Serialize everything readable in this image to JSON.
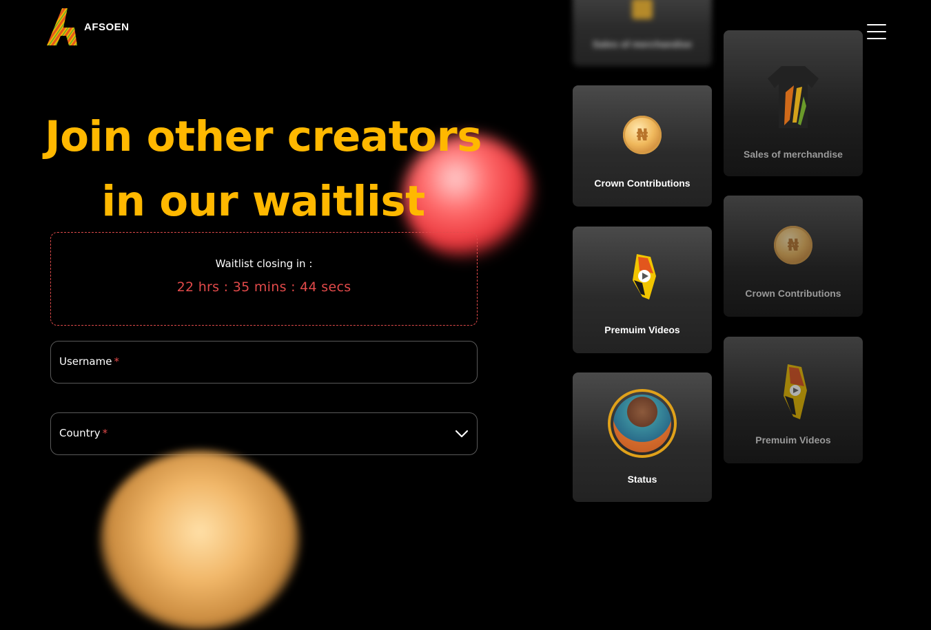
{
  "brand": {
    "name": "AFSOEN",
    "accent": "#ffb800",
    "danger": "#e24a4a"
  },
  "hero": {
    "line1": "Join other creators",
    "line2": "in our waitlist"
  },
  "countdown": {
    "label": "Waitlist closing in :",
    "value": "22 hrs : 35 mins : 44 secs"
  },
  "form": {
    "username_label": "Username",
    "country_label": "Country",
    "required_mark": "*"
  },
  "cards": {
    "top_partial": {
      "label": "Sales of merchandise"
    },
    "crown_1": {
      "label": "Crown Contributions",
      "icon": "naira-coin-icon"
    },
    "merch": {
      "label": "Sales of merchandise",
      "icon": "tshirt-icon"
    },
    "videos_1": {
      "label": "Premuim Videos",
      "icon": "video-badge-icon"
    },
    "crown_2": {
      "label": "Crown Contributions",
      "icon": "naira-coin-icon"
    },
    "status": {
      "label": "Status",
      "icon": "avatar"
    },
    "videos_2": {
      "label": "Premuim Videos",
      "icon": "video-badge-icon"
    }
  },
  "coin_symbol": "₦"
}
